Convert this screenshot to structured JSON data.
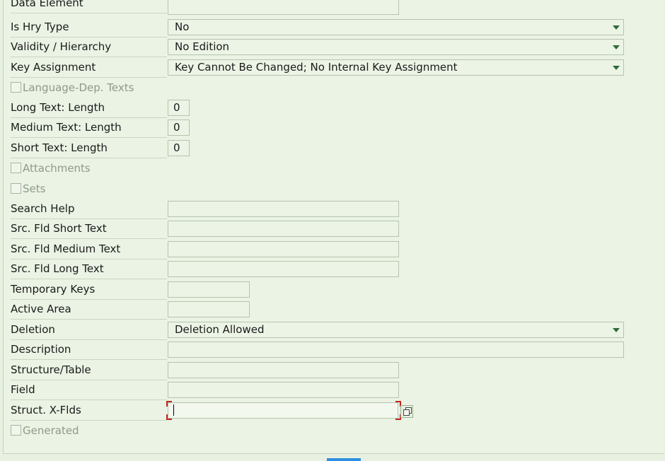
{
  "form": {
    "data_element": {
      "label": "Data Element",
      "value": ""
    },
    "is_hry_type": {
      "label": "Is Hry Type",
      "value": "No"
    },
    "validity_hierarchy": {
      "label": "Validity / Hierarchy",
      "value": "No Edition"
    },
    "key_assignment": {
      "label": "Key Assignment",
      "value": "Key Cannot Be Changed; No Internal Key Assignment"
    },
    "language_dep_texts": {
      "label": "Language-Dep. Texts",
      "checked": false
    },
    "long_text_length": {
      "label": "Long Text: Length",
      "value": "0"
    },
    "medium_text_length": {
      "label": "Medium Text: Length",
      "value": "0"
    },
    "short_text_length": {
      "label": "Short Text: Length",
      "value": "0"
    },
    "attachments": {
      "label": "Attachments",
      "checked": false
    },
    "sets": {
      "label": "Sets",
      "checked": false
    },
    "search_help": {
      "label": "Search Help",
      "value": ""
    },
    "src_fld_short_text": {
      "label": "Src. Fld Short Text",
      "value": ""
    },
    "src_fld_medium_text": {
      "label": "Src. Fld Medium Text",
      "value": ""
    },
    "src_fld_long_text": {
      "label": "Src. Fld Long Text",
      "value": ""
    },
    "temporary_keys": {
      "label": "Temporary Keys",
      "value": ""
    },
    "active_area": {
      "label": "Active Area",
      "value": ""
    },
    "deletion": {
      "label": "Deletion",
      "value": "Deletion Allowed"
    },
    "description": {
      "label": "Description",
      "value": ""
    },
    "structure_table": {
      "label": "Structure/Table",
      "value": ""
    },
    "field": {
      "label": "Field",
      "value": ""
    },
    "struct_x_flds": {
      "label": "Struct. X-Flds",
      "value": ""
    },
    "generated": {
      "label": "Generated",
      "checked": false
    }
  },
  "icons": {
    "dropdown": "dropdown-caret-icon",
    "value_help": "value-help-icon"
  },
  "colors": {
    "background": "#eaf3e4",
    "caret": "#2f6a3d",
    "focus": "#c0281e",
    "disabled_text": "#8f9a8a"
  }
}
